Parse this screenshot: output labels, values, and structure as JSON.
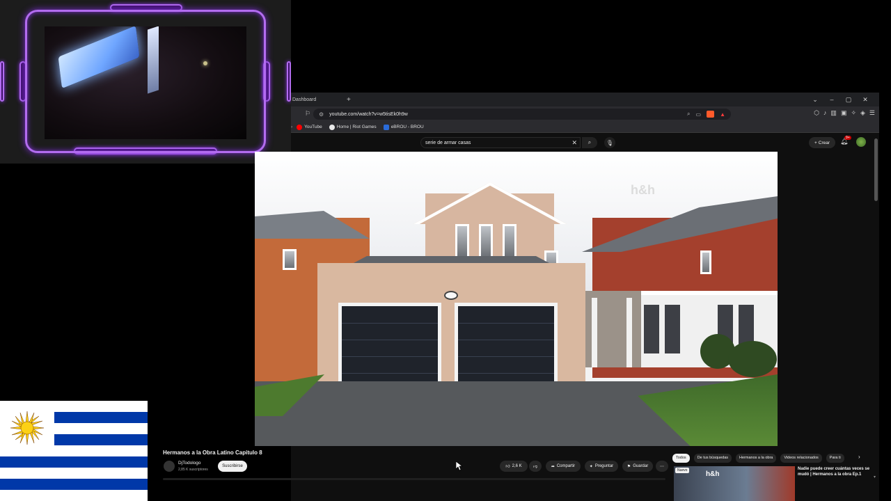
{
  "browser": {
    "tab_title": "Dashboard",
    "new_tab": "+",
    "window_controls": [
      "⌄",
      "–",
      "▢",
      "✕"
    ],
    "url": "youtube.com/watch?v=w5tisEk0h9w",
    "bookmarks": [
      {
        "label": "YouTube",
        "color": "#ff0000"
      },
      {
        "label": "Home | Riot Games",
        "color": "#e8e8e8"
      },
      {
        "label": "eBROU - BROU",
        "color": "#2a6bd8"
      }
    ]
  },
  "youtube": {
    "search_query": "serie de armar casas",
    "create_label": "Crear",
    "notif_count": "9+",
    "video": {
      "title": "Hermanos a la Obra Latino Capitulo 8",
      "watermark": "h&h"
    },
    "channel": {
      "name": "DjTodologo",
      "subs": "2,85 K suscriptores",
      "subscribe_label": "Suscribirse"
    },
    "actions": {
      "likes": "2,6 K",
      "share": "Compartir",
      "ask": "Preguntar",
      "save": "Guardar"
    },
    "chips": [
      "Todos",
      "De tus búsquedas",
      "Hermanos a la obra",
      "Videos relacionados",
      "Para ti"
    ],
    "related": {
      "badge": "Nuevo",
      "thumb_logo": "h&h",
      "title": "Nadie puede creer cuántas veces se mudó | Hermanos a la obra Ep.1"
    }
  },
  "overlay": {
    "flag": "Uruguay"
  }
}
